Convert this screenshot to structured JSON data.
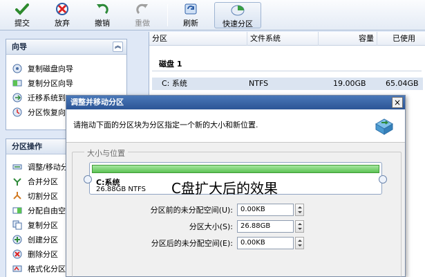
{
  "toolbar": {
    "commit": "提交",
    "discard": "放弃",
    "undo": "撤销",
    "redo": "重做",
    "refresh": "刷新",
    "quick_partition": "快速分区"
  },
  "wizard_panel": {
    "title": "向导",
    "items": [
      "复制磁盘向导",
      "复制分区向导",
      "迁移系统到",
      "分区恢复向"
    ]
  },
  "partition_panel": {
    "title": "分区操作",
    "items": [
      "调整/移动分",
      "合并分区",
      "切割分区",
      "分配自由空",
      "复制分区",
      "创建分区",
      "删除分区",
      "格式化分区"
    ]
  },
  "table": {
    "columns": [
      "分区",
      "文件系统",
      "容量",
      "已使用"
    ],
    "disk_label": "磁盘 1",
    "row": {
      "name": "C: 系统",
      "fs": "NTFS",
      "capacity": "19.00GB",
      "used": "65.04GB"
    }
  },
  "dialog": {
    "title": "调整并移动分区",
    "close": "×",
    "instruction": "请拖动下面的分区块为分区指定一个新的大小和新位置.",
    "group_label": "大小与位置",
    "partition_name": "C:系统",
    "partition_size": "26.88GB NTFS",
    "overlay_caption": "C盘扩大后的效果",
    "fields": [
      {
        "label": "分区前的未分配空间(U):",
        "value": "0.00KB"
      },
      {
        "label": "分区大小(S):",
        "value": "26.88GB"
      },
      {
        "label": "分区后的未分配空间(E):",
        "value": "0.00KB"
      }
    ]
  },
  "colors": {
    "accent": "#2c5596",
    "bar": "#5cc354"
  }
}
